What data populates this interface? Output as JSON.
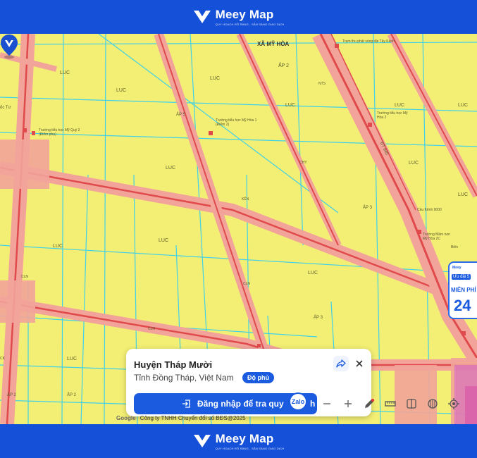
{
  "brand": {
    "name": "Meey Map",
    "tagline": "QUY HOẠCH RÕ RÀNG - SẴN SÀNG GIAO DỊCH"
  },
  "colors": {
    "brand_blue": "#1550d8",
    "map_land": "#f3ef74",
    "road": "#e8686a",
    "canal": "#40d0e8"
  },
  "map": {
    "labels": {
      "commune": "XÃ MỸ HÒA",
      "luc": "LUC",
      "ap2": "ẤP 2",
      "ap3": "ẤP 3",
      "ap5": "ẤP 5",
      "nts": "NTS",
      "cln": "CLN",
      "skc": "SKC",
      "ken": "KÊN",
      "chy": "CHY",
      "dt845": "ĐT 845",
      "school1": "Trường tiểu học Mỹ Hòa 1 (Điểm 2)",
      "school2": "Trường tiểu học Mỹ Hòa 2",
      "school3": "Trường tiểu học Mỹ Quý 2 (Điểm phụ)",
      "school4": "Trường Mầm non Mỹ Hòa 2C",
      "bridge": "Cầu Kênh 9000",
      "radio": "Trạm thu phát sóng đài Tây Kênh",
      "tu": "ốc Tư",
      "bien": "Biên",
      "ck": "CK"
    }
  },
  "popup": {
    "title": "Huyện Tháp Mười",
    "subtitle": "Tỉnh Đồng Tháp, Việt Nam",
    "badge": "Độ phủ",
    "login_label": "Đăng nhập để tra quy",
    "login_tail": "h"
  },
  "zalo": "Zalo",
  "ad": {
    "brand": "Meey",
    "promo": "Ưu đãi 5",
    "free": "MIỄN PHÍ",
    "number": "24"
  },
  "credit": {
    "google": "Google",
    "text": "Công ty TNHH Chuyển đổi số BĐS@2025"
  },
  "icons": {
    "share": "share-icon",
    "close": "close-icon",
    "login": "login-icon",
    "zoom_out": "minus-icon",
    "zoom_in": "plus-icon",
    "pencil": "pencil-icon",
    "ruler": "ruler-icon",
    "split": "split-icon",
    "layers": "layers-icon",
    "locate": "locate-icon"
  }
}
